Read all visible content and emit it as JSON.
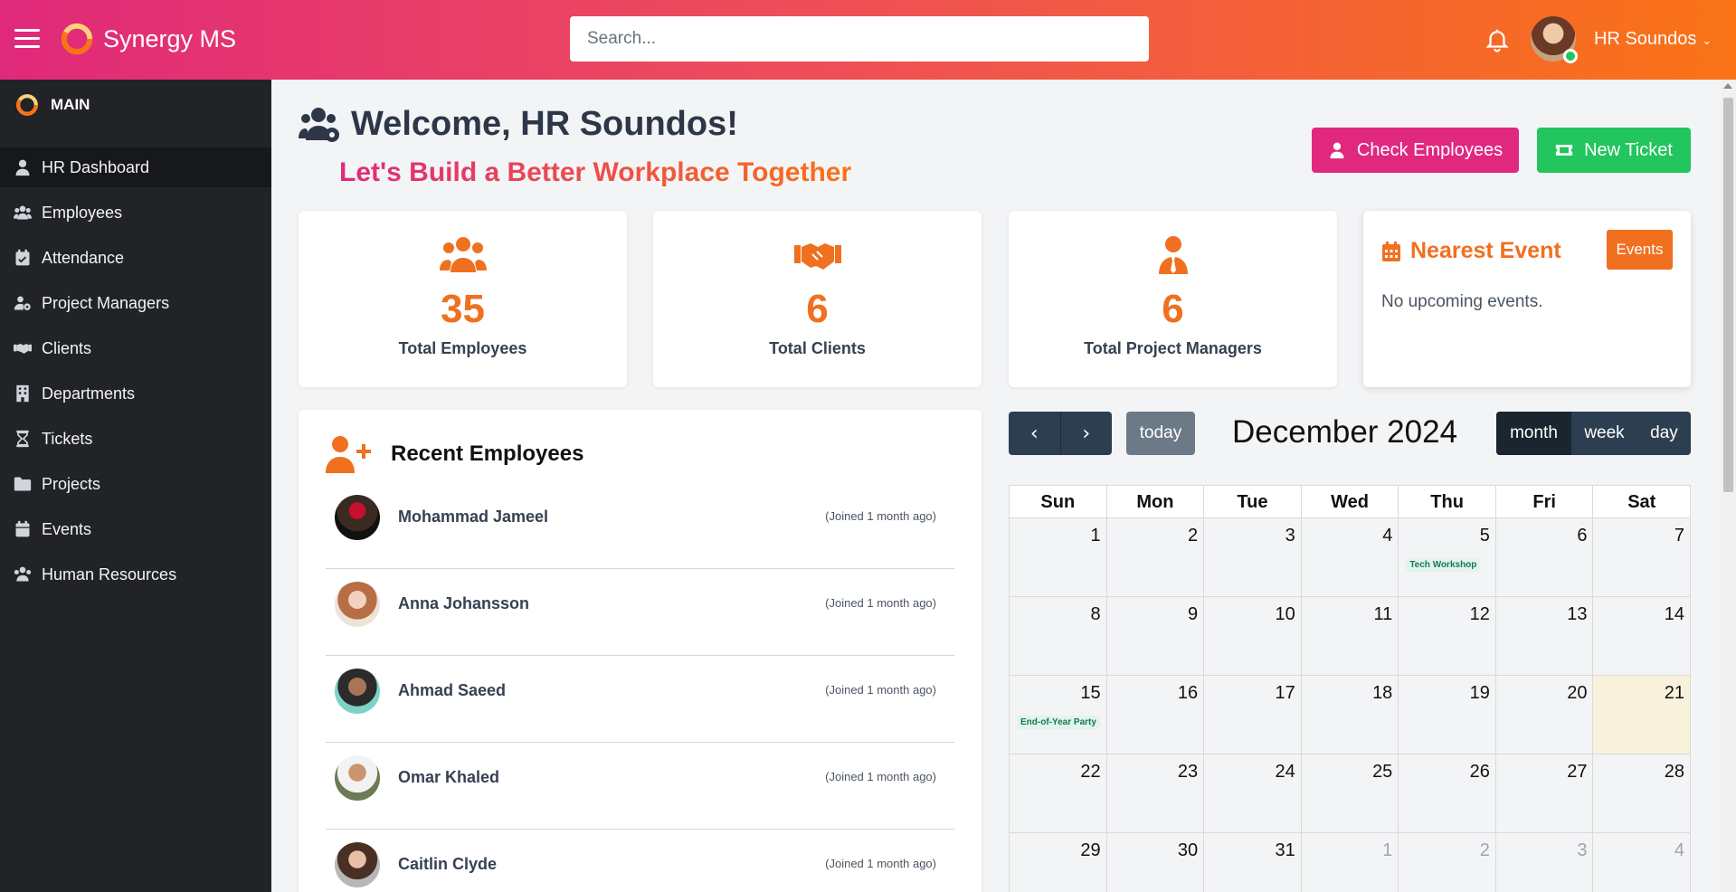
{
  "header": {
    "brand": "Synergy MS",
    "search_placeholder": "Search...",
    "user_name": "HR Soundos"
  },
  "sidebar": {
    "section": "MAIN",
    "items": [
      {
        "label": "HR Dashboard",
        "icon": "user-tie-icon"
      },
      {
        "label": "Employees",
        "icon": "users-icon"
      },
      {
        "label": "Attendance",
        "icon": "calendar-check-icon"
      },
      {
        "label": "Project Managers",
        "icon": "users-cog-icon"
      },
      {
        "label": "Clients",
        "icon": "handshake-icon"
      },
      {
        "label": "Departments",
        "icon": "building-icon"
      },
      {
        "label": "Tickets",
        "icon": "hourglass-icon"
      },
      {
        "label": "Projects",
        "icon": "folder-icon"
      },
      {
        "label": "Events",
        "icon": "calendar-icon"
      },
      {
        "label": "Human Resources",
        "icon": "users-cog-icon"
      }
    ]
  },
  "main": {
    "welcome": "Welcome, HR Soundos!",
    "tagline": "Let's Build a Better Workplace Together",
    "check_employees": "Check Employees",
    "new_ticket": "New Ticket"
  },
  "stats": [
    {
      "value": "35",
      "label": "Total Employees"
    },
    {
      "value": "6",
      "label": "Total Clients"
    },
    {
      "value": "6",
      "label": "Total Project Managers"
    }
  ],
  "nearest_event": {
    "title": "Nearest Event",
    "button": "Events",
    "empty": "No upcoming events."
  },
  "recent_employees": {
    "title": "Recent Employees",
    "items": [
      {
        "name": "Mohammad Jameel",
        "joined": "(Joined 1 month ago)"
      },
      {
        "name": "Anna Johansson",
        "joined": "(Joined 1 month ago)"
      },
      {
        "name": "Ahmad Saeed",
        "joined": "(Joined 1 month ago)"
      },
      {
        "name": "Omar Khaled",
        "joined": "(Joined 1 month ago)"
      },
      {
        "name": "Caitlin Clyde",
        "joined": "(Joined 1 month ago)"
      }
    ]
  },
  "calendar": {
    "title": "December 2024",
    "today_label": "today",
    "views": [
      "month",
      "week",
      "day"
    ],
    "active_view": "month",
    "weekdays": [
      "Sun",
      "Mon",
      "Tue",
      "Wed",
      "Thu",
      "Fri",
      "Sat"
    ],
    "weeks": [
      [
        "1",
        "2",
        "3",
        "4",
        "5",
        "6",
        "7"
      ],
      [
        "8",
        "9",
        "10",
        "11",
        "12",
        "13",
        "14"
      ],
      [
        "15",
        "16",
        "17",
        "18",
        "19",
        "20",
        "21"
      ],
      [
        "22",
        "23",
        "24",
        "25",
        "26",
        "27",
        "28"
      ],
      [
        "29",
        "30",
        "31",
        "1",
        "2",
        "3",
        "4"
      ]
    ],
    "today": "21",
    "events": [
      {
        "day": "5",
        "title": "Tech Workshop"
      },
      {
        "day": "15",
        "title": "End-of-Year Party"
      }
    ]
  },
  "colors": {
    "accent_orange": "#f07020",
    "accent_pink": "#e0287f",
    "green": "#22c55e",
    "sidebar": "#212327",
    "calendar_dark": "#2c3e50"
  }
}
